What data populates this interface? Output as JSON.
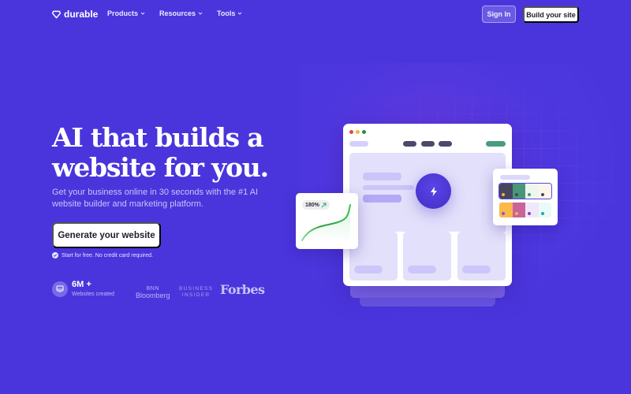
{
  "nav": {
    "brand": "durable",
    "links": [
      {
        "label": "Products"
      },
      {
        "label": "Resources"
      },
      {
        "label": "Tools"
      }
    ],
    "signin_label": "Sign In",
    "build_label": "Build your site"
  },
  "hero": {
    "title_line1": "AI that builds a",
    "title_line2": "website for you.",
    "subtitle": "Get your business online in 30 seconds with the #1 AI website builder and marketing platform.",
    "cta_label": "Generate your website",
    "note": "Start for free. No credit card required."
  },
  "stats": {
    "value": "6M +",
    "label": "Websites created"
  },
  "press": {
    "bnn_top": "BNN",
    "bnn_bottom": "Bloomberg",
    "bi_top": "BUSINESS",
    "bi_bottom": "INSIDER",
    "forbes": "Forbes"
  },
  "illustration": {
    "growth_badge": "180%",
    "window_dot_colors": [
      "#e8453c",
      "#f5b73b",
      "#2f8a46"
    ],
    "nav_pill_color": "#4a4a6a",
    "accent_pill_color": "#4a9c7e",
    "palettes": [
      {
        "selected": true,
        "colors": [
          "#46465e",
          "#4a9679",
          "#eef6f0",
          "#fbf5ea"
        ],
        "dots": [
          "#f5b342",
          "#46465e",
          "#4a9679",
          "#46465e"
        ]
      },
      {
        "selected": false,
        "colors": [
          "#f9b94b",
          "#c9639b",
          "#efe8f8",
          "#e9fbf9"
        ],
        "dots": [
          "#9b4fc4",
          "#f5b342",
          "#7a44c8",
          "#2aa3a3"
        ]
      }
    ]
  },
  "colors": {
    "background": "#4a35dc",
    "accent": "#5a43e8"
  }
}
